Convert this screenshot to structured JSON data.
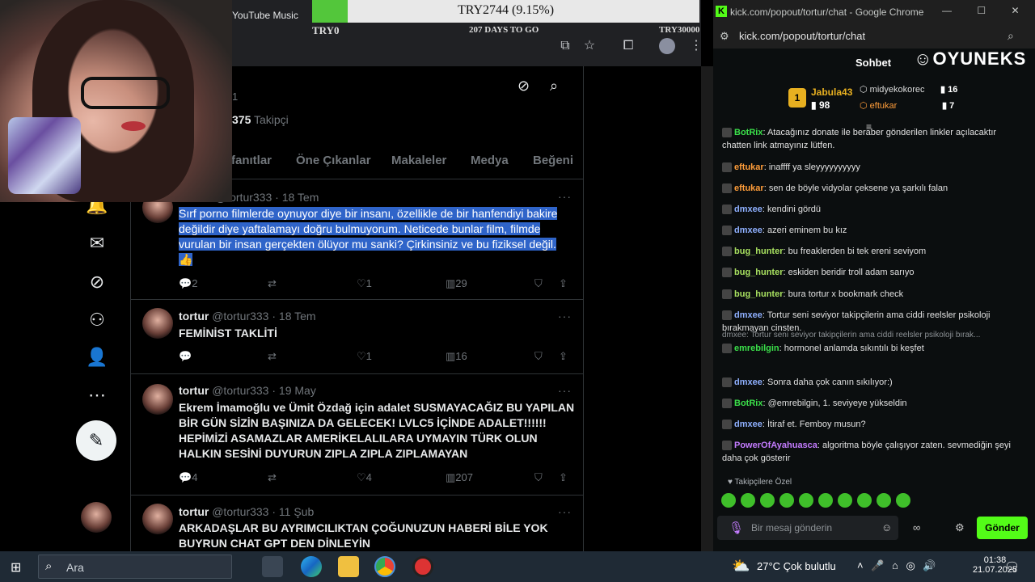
{
  "browser": {
    "yt_label": "YouTube Music",
    "goal": {
      "text": "TRY2744 (9.15%)",
      "fill_percent": 9.15,
      "left_label": "TRY0",
      "days_left": "207 DAYS TO GO",
      "right_label": "TRY30000"
    }
  },
  "profile": {
    "number": "1",
    "followers_count": "375",
    "followers_label": "Takipçi",
    "tabs": [
      "fanıtlar",
      "Öne Çıkanlar",
      "Makaleler",
      "Medya",
      "Beğeni"
    ]
  },
  "tweets": [
    {
      "name": "",
      "handle": "@tortur333",
      "time": "18 Tem",
      "text": "Sırf porno filmlerde oynuyor diye bir insanı, özellikle de bir hanfendiyi bakire değildir diye yaftalamayı doğru bulmuyorum. Neticede bunlar film, filmde vurulan bir insan gerçekten ölüyor mu sanki? Çirkinsiniz ve bu fiziksel değil.",
      "emoji": "👍",
      "replies": "2",
      "retweets": "",
      "likes": "1",
      "views": "29"
    },
    {
      "name": "tortur",
      "handle": "@tortur333",
      "time": "18 Tem",
      "text": "FEMİNİST TAKLİTİ",
      "replies": "",
      "retweets": "",
      "likes": "1",
      "views": "16"
    },
    {
      "name": "tortur",
      "handle": "@tortur333",
      "time": "19 May",
      "text": "Ekrem İmamoğlu ve Ümit Özdağ için adalet SUSMAYACAĞIZ BU YAPILAN BİR GÜN SİZİN BAŞINIZA DA GELECEK! LVLC5 İÇİNDE ADALET!!!!!! HEPİMİZİ ASAMAZLAR AMERİKELALILARA UYMAYIN TÜRK OLUN HALKIN SESİNİ DUYURUN ZIPLA ZIPLA ZIPLAMAYAN",
      "replies": "4",
      "retweets": "",
      "likes": "4",
      "views": "207"
    },
    {
      "name": "tortur",
      "handle": "@tortur333",
      "time": "11 Şub",
      "text": "ARKADAŞLAR BU AYRIMCILIKTAN ÇOĞUNUZUN HABERİ BİLE YOK BUYRUN CHAT GPT DEN DİNLEYİN"
    }
  ],
  "chat_window": {
    "title": "kick.com/popout/tortur/chat - Google Chrome",
    "url": "kick.com/popout/tortur/chat",
    "header": "Sohbet",
    "brand": "OYUNEKS",
    "leaderboard": [
      {
        "rank": "1",
        "name": "Jabula43",
        "count": "98"
      },
      {
        "name": "midyekokorec",
        "count": "16"
      },
      {
        "name": "eftukar",
        "count": "7"
      }
    ],
    "messages": [
      {
        "user": "BotRix",
        "text": "Atacağınız donate ile beraber gönderilen linkler açılacaktır chatten link atmayınız lütfen.",
        "color": "#3be04a"
      },
      {
        "user": "eftukar",
        "text": "inaffff ya sleyyyyyyyyyy",
        "color": "#ff9d3a"
      },
      {
        "user": "eftukar",
        "text": "sen de böyle vidyolar çeksene ya şarkılı falan",
        "color": "#ff9d3a"
      },
      {
        "user": "dmxee",
        "text": "kendini gördü",
        "color": "#8fb0ff"
      },
      {
        "user": "dmxee",
        "text": "azeri eminem bu kız",
        "color": "#8fb0ff"
      },
      {
        "user": "bug_hunter",
        "text": "bu freaklerden bi tek ereni seviyom",
        "color": "#a8e060"
      },
      {
        "user": "bug_hunter",
        "text": "eskiden beridir troll adam sarıyo",
        "color": "#a8e060"
      },
      {
        "user": "bug_hunter",
        "text": "bura tortur x bookmark check",
        "color": "#a8e060"
      },
      {
        "user": "dmxee",
        "text": "Tortur seni seviyor takipçilerin ama ciddi reelsler psikoloji bırakmayan cinsten.",
        "color": "#8fb0ff"
      },
      {
        "reply": "dmxee: Tortur seni seviyor takipçilerin ama ciddi reelsler psikoloji bırak...",
        "user": "emrebilgin",
        "text": "hormonel anlamda sıkıntılı bi keşfet",
        "color": "#3be04a"
      },
      {
        "user": "dmxee",
        "text": "Sonra daha çok canın sıkılıyor:)",
        "color": "#8fb0ff"
      },
      {
        "user": "BotRix",
        "text": "@emrebilgin, 1. seviyeye yükseldin",
        "color": "#3be04a"
      },
      {
        "user": "dmxee",
        "text": "İtiraf et. Femboy musun?",
        "color": "#8fb0ff"
      },
      {
        "user": "PowerOfAyahuasca",
        "text": "algoritma böyle çalışıyor zaten. sevmediğin şeyi daha çok gösterir",
        "color": "#c47cff"
      }
    ],
    "followers_only": "Takipçilere Özel",
    "input_placeholder": "Bir mesaj gönderin",
    "send_label": "Gönder"
  },
  "taskbar": {
    "search": "Ara",
    "weather": "27°C  Çok bulutlu",
    "time": "01:38",
    "date": "21.07.2025"
  }
}
